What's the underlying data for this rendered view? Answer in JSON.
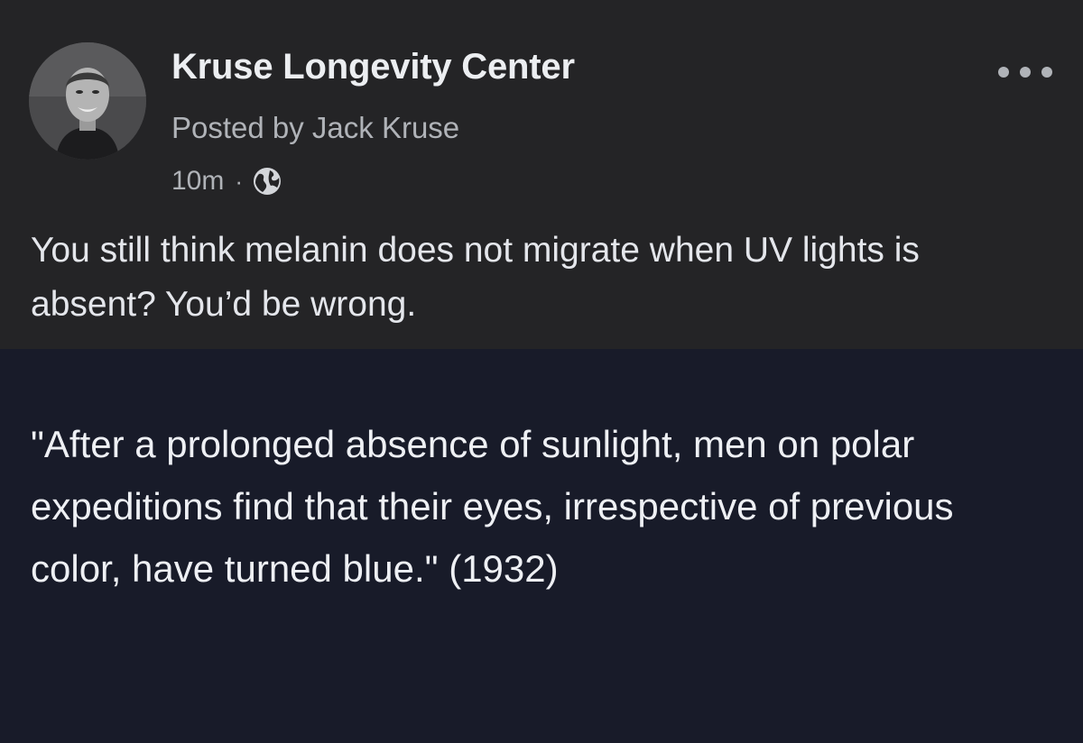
{
  "post": {
    "page_name": "Kruse Longevity Center",
    "posted_by": "Posted by Jack Kruse",
    "timestamp": "10m",
    "separator": "·",
    "audience_icon": "globe-icon",
    "more_icon": "more-options-icon",
    "body": "You still think melanin does not migrate when UV lights is absent?  You’d be wrong."
  },
  "quote_card": {
    "text": "\"After a prolonged absence of sunlight, men on polar expeditions find that their eyes, irrespective of previous color, have turned blue.\" (1932)"
  },
  "colors": {
    "post_background": "#242426",
    "quote_background": "#181b29",
    "primary_text": "#e4e6eb",
    "secondary_text": "#b0b3b8"
  }
}
